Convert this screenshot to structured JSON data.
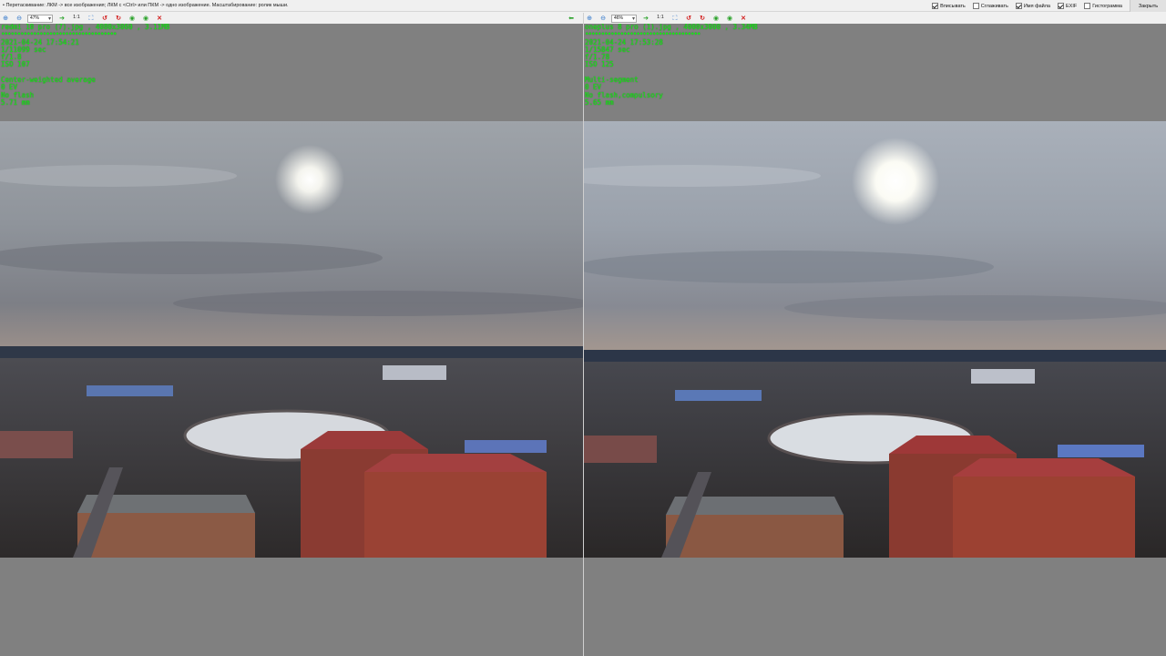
{
  "hint_bar": {
    "text": "• Перетаскивание: ЛКМ -> все изображения; ЛКМ с <Ctrl> или ПКМ -> одно изображение. Масштабирование: ролик мыши."
  },
  "options": [
    {
      "label": "Вписывать",
      "checked": true
    },
    {
      "label": "Сглаживать",
      "checked": false
    },
    {
      "label": "Имя файла",
      "checked": true
    },
    {
      "label": "EXIF",
      "checked": true
    },
    {
      "label": "Гистограмма",
      "checked": false
    }
  ],
  "close_label": "Закрыть",
  "left": {
    "zoom": "47%",
    "one_to_one": "1:1",
    "info": {
      "filename": "redmi 10 pro (7).jpg  ,  4080x3060  ,  3.11MB",
      "dots": "••••••••••••••••••••••••••••••••••••",
      "datetime": "2021-04-24 17:54:21",
      "shutter": "1/11099 sec",
      "aperture": "f/1.8",
      "iso": "ISO 107",
      "metering": "Center-weighted average",
      "ev": "0 EV",
      "flash": "No flash",
      "focal": "5.71 mm"
    }
  },
  "right": {
    "zoom": "46%",
    "one_to_one": "1:1",
    "info": {
      "filename": "oneplus 8 pro (1).jpg  ,  4000x3000  ,  3.34MB",
      "dots": "••••••••••••••••••••••••••••••••••••",
      "datetime": "2021-04-24 17:53:28",
      "shutter": "1/15847 sec",
      "aperture": "f/1.78",
      "iso": "ISO 125",
      "metering": "Multi-segment",
      "ev": "0 EV",
      "flash": "No flash,compulsory",
      "focal": "5.65 mm"
    }
  },
  "icons": {
    "zoom_in": "zoom-in-icon",
    "zoom_out": "zoom-out-icon",
    "next": "next-arrow-icon",
    "fit": "fit-to-window-icon",
    "rotate_left": "rotate-left-icon",
    "rotate_right": "rotate-right-icon",
    "prev_image": "previous-image-icon",
    "next_image": "next-image-icon",
    "close": "close-x-icon",
    "back": "back-arrow-icon"
  },
  "colors": {
    "exif_text": "#18f018",
    "pane_background": "#808080",
    "close_icon": "#d21e1e"
  }
}
